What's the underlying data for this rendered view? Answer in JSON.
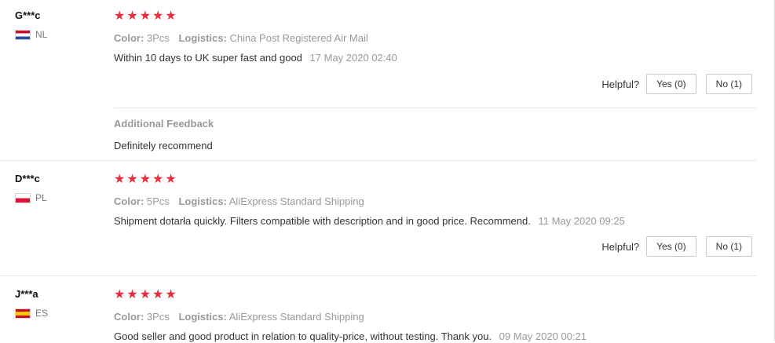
{
  "reviews": [
    {
      "user": "G***c",
      "country": "NL",
      "stars": [
        "★",
        "★",
        "★",
        "★",
        "★"
      ],
      "color_label": "Color:",
      "color_value": "3Pcs",
      "logistics_label": "Logistics:",
      "logistics_value": "China Post Registered Air Mail",
      "text": "Within 10 days to UK super fast and good",
      "date": "17 May 2020 02:40",
      "helpful_label": "Helpful?",
      "yes_label": "Yes (0)",
      "no_label": "No (1)",
      "additional_title": "Additional Feedback",
      "additional_text": "Definitely recommend"
    },
    {
      "user": "D***c",
      "country": "PL",
      "stars": [
        "★",
        "★",
        "★",
        "★",
        "★"
      ],
      "color_label": "Color:",
      "color_value": "5Pcs",
      "logistics_label": "Logistics:",
      "logistics_value": "AliExpress Standard Shipping",
      "text": "Shipment dotarła quickly. Filters compatible with description and in good price. Recommend.",
      "date": "11 May 2020 09:25",
      "helpful_label": "Helpful?",
      "yes_label": "Yes (0)",
      "no_label": "No (1)"
    },
    {
      "user": "J***a",
      "country": "ES",
      "stars": [
        "★",
        "★",
        "★",
        "★",
        "★"
      ],
      "color_label": "Color:",
      "color_value": "3Pcs",
      "logistics_label": "Logistics:",
      "logistics_value": "AliExpress Standard Shipping",
      "text": "Good seller and good product in relation to quality-price, without testing. Thank you.",
      "date": "09 May 2020 00:21"
    }
  ],
  "colors": {
    "star": "#e62e3d",
    "muted_text": "#999999",
    "body_text": "#333333",
    "divider": "#e6e6e6"
  }
}
